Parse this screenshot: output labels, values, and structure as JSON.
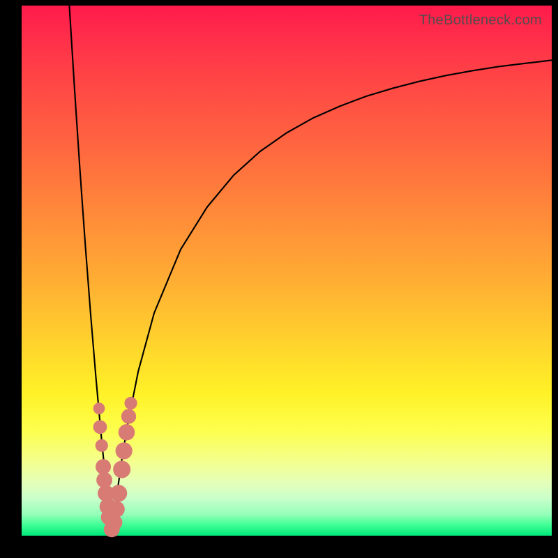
{
  "watermark": "TheBottleneck.com",
  "chart_data": {
    "type": "line",
    "title": "",
    "xlabel": "",
    "ylabel": "",
    "xlim": [
      0,
      100
    ],
    "ylim": [
      0,
      100
    ],
    "optimum_x": 17,
    "series": [
      {
        "name": "curve-left",
        "x": [
          9,
          10,
          11,
          12,
          13,
          14,
          15,
          16,
          17
        ],
        "y": [
          100,
          84,
          69,
          55,
          42,
          30,
          19,
          9,
          0
        ]
      },
      {
        "name": "curve-right",
        "x": [
          17,
          18,
          19,
          20,
          22,
          25,
          30,
          35,
          40,
          45,
          50,
          55,
          60,
          65,
          70,
          75,
          80,
          85,
          90,
          95,
          100
        ],
        "y": [
          0,
          8,
          15,
          21,
          31,
          42,
          54,
          62,
          68,
          72.5,
          76,
          78.8,
          81,
          82.9,
          84.4,
          85.7,
          86.8,
          87.7,
          88.5,
          89.1,
          89.7
        ]
      }
    ],
    "scatter": {
      "name": "markers",
      "color": "#d97b75",
      "points": [
        {
          "x": 14.6,
          "y": 24.0,
          "r": 1.1
        },
        {
          "x": 14.8,
          "y": 20.5,
          "r": 1.3
        },
        {
          "x": 15.1,
          "y": 17.0,
          "r": 1.2
        },
        {
          "x": 15.4,
          "y": 13.0,
          "r": 1.45
        },
        {
          "x": 15.6,
          "y": 10.5,
          "r": 1.5
        },
        {
          "x": 15.9,
          "y": 8.0,
          "r": 1.55
        },
        {
          "x": 16.3,
          "y": 5.5,
          "r": 1.6
        },
        {
          "x": 16.5,
          "y": 3.5,
          "r": 1.55
        },
        {
          "x": 17.0,
          "y": 1.2,
          "r": 1.5
        },
        {
          "x": 17.5,
          "y": 2.5,
          "r": 1.5
        },
        {
          "x": 17.9,
          "y": 5.0,
          "r": 1.55
        },
        {
          "x": 18.3,
          "y": 8.0,
          "r": 1.6
        },
        {
          "x": 18.9,
          "y": 12.5,
          "r": 1.65
        },
        {
          "x": 19.3,
          "y": 16.0,
          "r": 1.6
        },
        {
          "x": 19.8,
          "y": 19.5,
          "r": 1.55
        },
        {
          "x": 20.2,
          "y": 22.5,
          "r": 1.4
        },
        {
          "x": 20.6,
          "y": 25.0,
          "r": 1.2
        }
      ]
    }
  }
}
